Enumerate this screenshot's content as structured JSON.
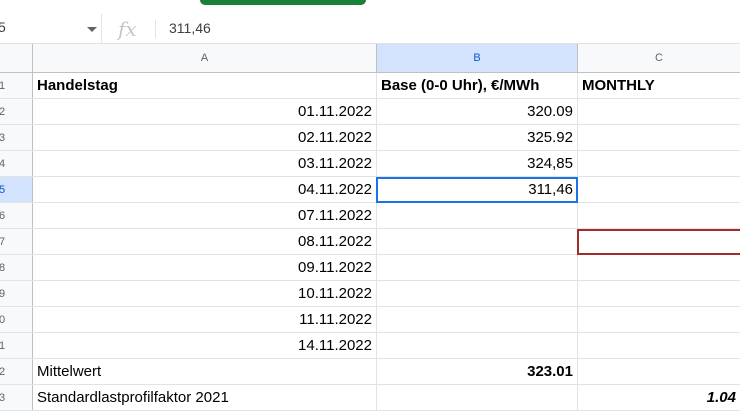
{
  "formula_bar": {
    "name_box": "5",
    "fx_label": "fx",
    "value": "311,46"
  },
  "columns": [
    "A",
    "B",
    "C"
  ],
  "headers": {
    "row_num": "1",
    "a": "Handelstag",
    "b": "Base (0-0 Uhr), €/MWh",
    "c": "MONTHLY"
  },
  "rows": [
    {
      "num": "2",
      "date": "01.11.2022",
      "value": "320.09"
    },
    {
      "num": "3",
      "date": "02.11.2022",
      "value": "325.92"
    },
    {
      "num": "4",
      "date": "03.11.2022",
      "value": "324,85"
    },
    {
      "num": "5",
      "date": "04.11.2022",
      "value": "311,46"
    },
    {
      "num": "6",
      "date": "07.11.2022",
      "value": ""
    },
    {
      "num": "7",
      "date": "08.11.2022",
      "value": ""
    },
    {
      "num": "8",
      "date": "09.11.2022",
      "value": ""
    },
    {
      "num": "9",
      "date": "10.11.2022",
      "value": ""
    },
    {
      "num": "0",
      "date": "11.11.2022",
      "value": ""
    },
    {
      "num": "1",
      "date": "14.11.2022",
      "value": ""
    }
  ],
  "summary": [
    {
      "num": "2",
      "label": "Mittelwert",
      "b": "323.01",
      "c": ""
    },
    {
      "num": "3",
      "label": "Standardlastprofilfaktor 2021",
      "b": "",
      "c": "1.04"
    }
  ],
  "colors": {
    "selection": "#1a73e8",
    "highlight_border": "#a12c2c",
    "header_bg": "#f8f9fa",
    "selected_header_bg": "#d3e3fd",
    "toolbar_green": "#188038"
  }
}
